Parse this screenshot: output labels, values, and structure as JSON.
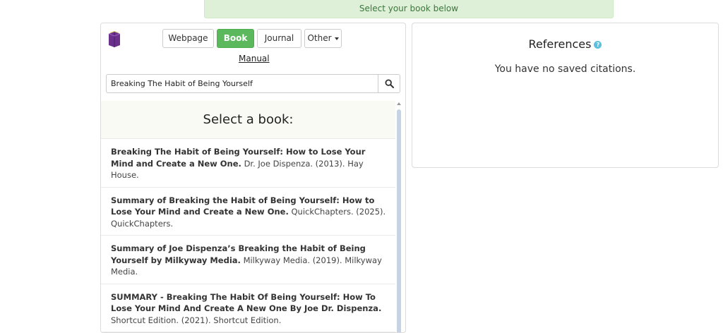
{
  "banner": {
    "text": "Select your book below"
  },
  "source_types": {
    "webpage": "Webpage",
    "book": "Book",
    "journal": "Journal",
    "other": "Other",
    "manual": "Manual"
  },
  "search": {
    "value": "Breaking The Habit of Being Yourself"
  },
  "results": {
    "heading": "Select a book:",
    "items": [
      {
        "title": "Breaking The Habit of Being Yourself: How to Lose Your Mind and Create a New One.",
        "details": "Dr. Joe Dispenza. (2013). Hay House."
      },
      {
        "title": "Summary of Breaking the Habit of Being Yourself: How to Lose Your Mind and Create a New One.",
        "details": "QuickChapters. (2025). QuickChapters."
      },
      {
        "title": "Summary of Joe Dispenza’s Breaking the Habit of Being Yourself by Milkyway Media.",
        "details": "Milkyway Media. (2019). Milkyway Media."
      },
      {
        "title": "SUMMARY - Breaking The Habit Of Being Yourself: How To Lose Your Mind And Create A New One By Joe Dr. Dispenza.",
        "details": "Shortcut Edition. (2021). Shortcut Edition."
      }
    ]
  },
  "references": {
    "title": "References",
    "help": "?",
    "empty": "You have no saved citations."
  },
  "icons": {
    "logo": "book-icon",
    "search": "search-icon",
    "help": "question-icon"
  },
  "colors": {
    "primary": "#5cb85c",
    "banner_bg": "#dff0d8",
    "banner_text": "#3c763d",
    "info": "#5bc0de",
    "logo": "#6b2f8c"
  }
}
